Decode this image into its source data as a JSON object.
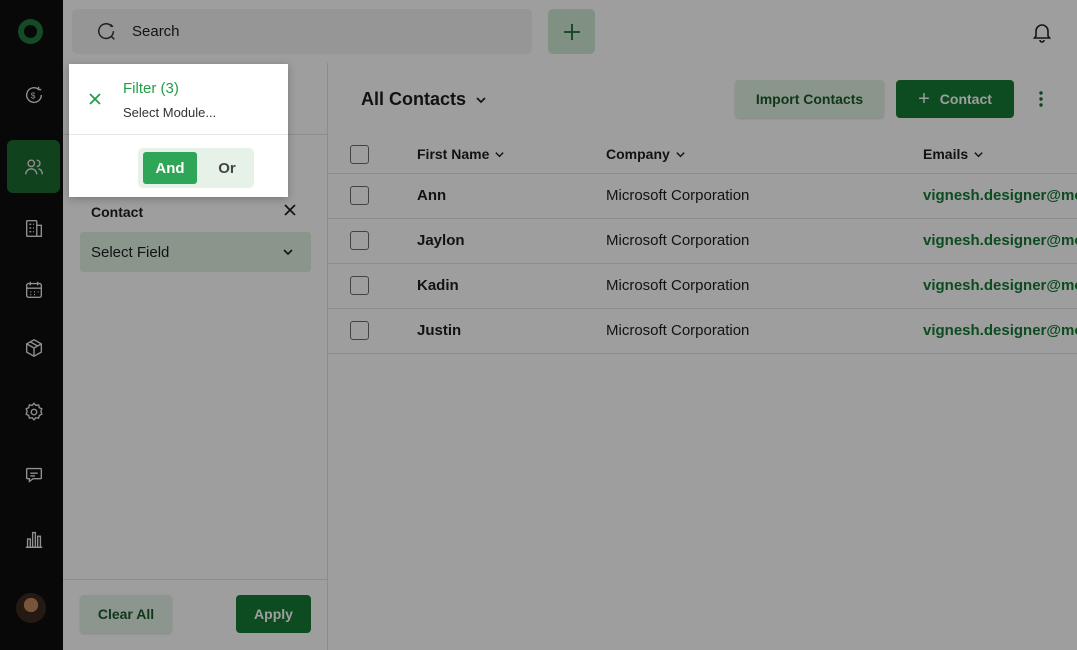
{
  "search": {
    "placeholder": "Search"
  },
  "sidebar": {
    "items": [
      {
        "icon": "dollar-cycle-icon"
      },
      {
        "icon": "users-icon",
        "active": true
      },
      {
        "icon": "building-icon"
      },
      {
        "icon": "calendar-icon"
      },
      {
        "icon": "box-icon"
      },
      {
        "icon": "gear-icon"
      },
      {
        "icon": "chat-icon"
      },
      {
        "icon": "bar-chart-icon"
      }
    ]
  },
  "filter_panel": {
    "field_group_label": "Contact",
    "select_field_value": "Select Field",
    "clear_label": "Clear All",
    "apply_label": "Apply"
  },
  "popup": {
    "title": "Filter (3)",
    "subtitle": "Select Module...",
    "and_label": "And",
    "or_label": "Or",
    "selected": "And"
  },
  "main": {
    "view_title": "All Contacts",
    "import_label": "Import Contacts",
    "contact_label": "Contact",
    "columns": [
      "First Name",
      "Company",
      "Emails"
    ],
    "rows": [
      {
        "first": "Ann",
        "company": "Microsoft Corporation",
        "email": "vignesh.designer@mo"
      },
      {
        "first": "Jaylon",
        "company": "Microsoft Corporation",
        "email": "vignesh.designer@mo"
      },
      {
        "first": "Kadin",
        "company": "Microsoft Corporation",
        "email": "vignesh.designer@mo"
      },
      {
        "first": "Justin",
        "company": "Microsoft Corporation",
        "email": "vignesh.designer@mo"
      }
    ]
  },
  "colors": {
    "brand_green": "#157a35",
    "accent_green": "#2fa557",
    "light_green": "#dff1e3"
  }
}
